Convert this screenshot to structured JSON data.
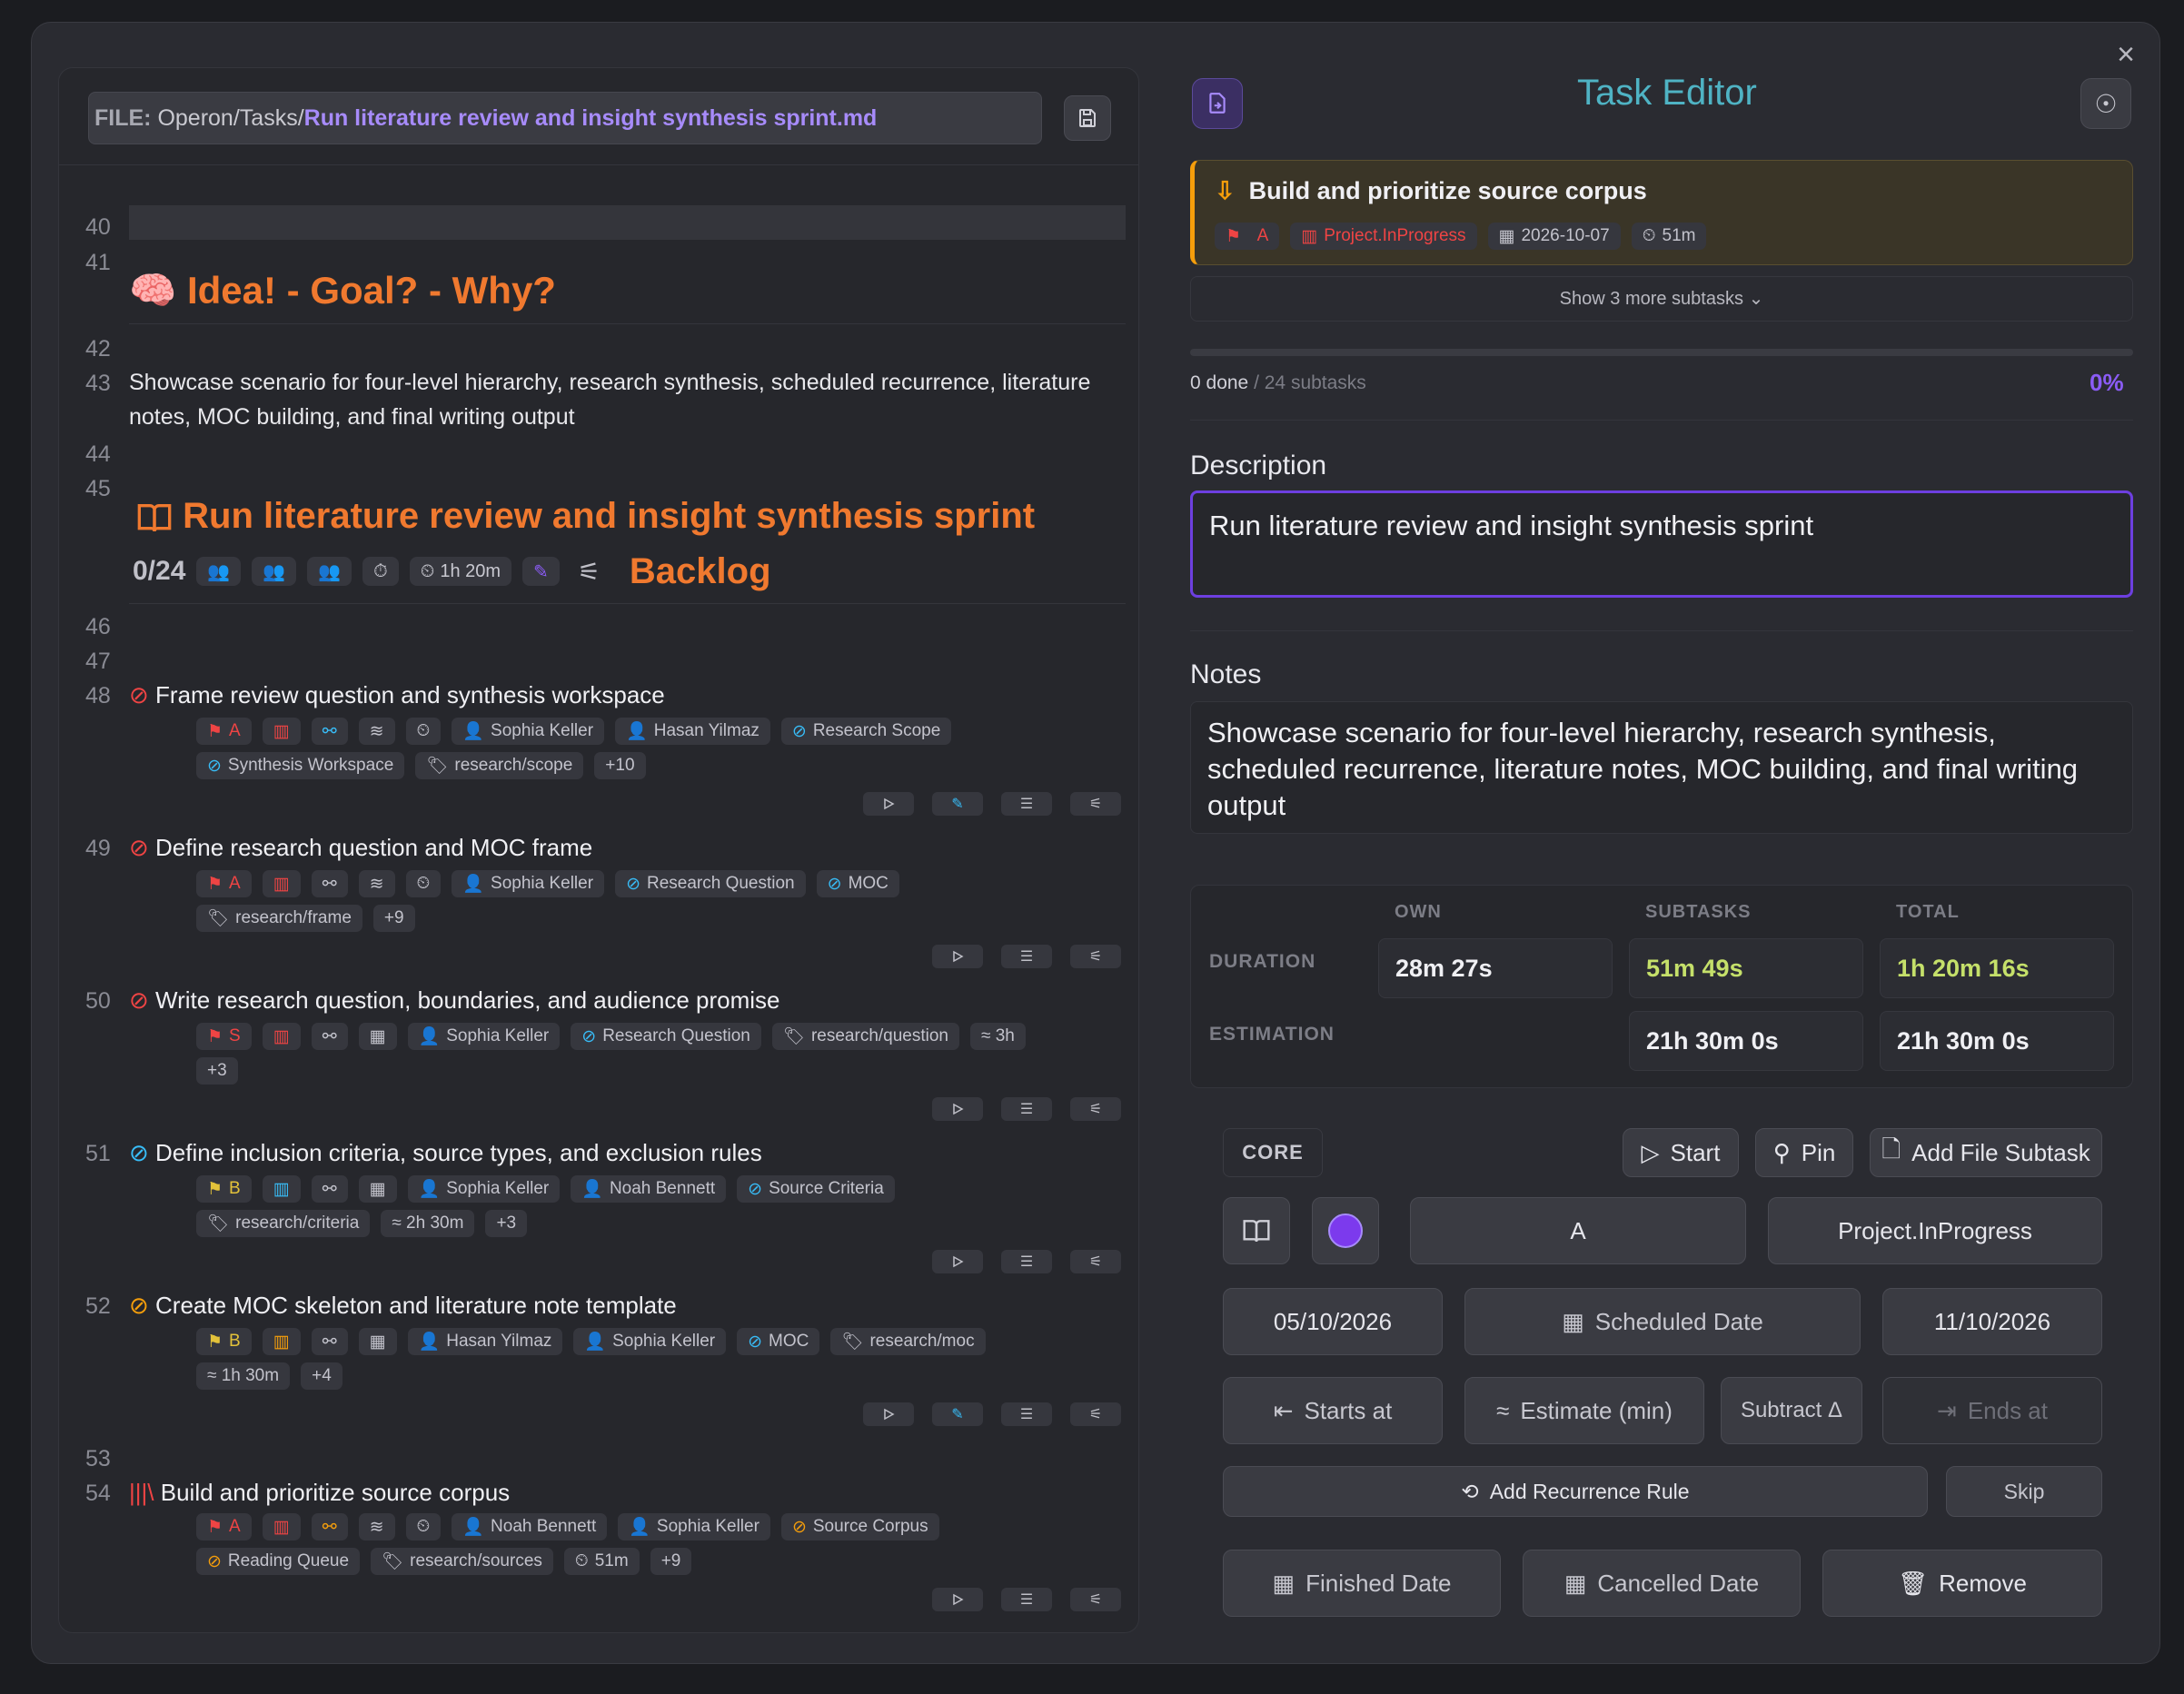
{
  "file_bar": {
    "label": "FILE:",
    "path": "Operon/Tasks/",
    "filename": "Run literature review and insight synthesis sprint.md"
  },
  "editor": {
    "lines": {
      "l40": "40",
      "l41": "41",
      "l42": "42",
      "l43": "43",
      "l44": "44",
      "l45": "45",
      "l46": "46",
      "l47": "47",
      "l48": "48",
      "l49": "49",
      "l50": "50",
      "l51": "51",
      "l52": "52",
      "l53": "53",
      "l54": "54"
    },
    "heading1": "Idea! - Goal? - Why?",
    "paragraph": "Showcase scenario for four-level hierarchy, research synthesis, scheduled recurrence, literature notes, MOC building, and final writing output",
    "task_heading": "Run literature review and insight synthesis sprint",
    "progress": "0/24",
    "duration_tag": "1h 20m",
    "status_heading": "Backlog",
    "tasks": [
      {
        "title": "Frame review question and synthesis workspace",
        "priority": "A",
        "chips": [
          "Sophia Keller",
          "Hasan Yilmaz",
          "Research Scope",
          "Synthesis Workspace",
          "research/scope",
          "+10"
        ]
      },
      {
        "title": "Define research question and MOC frame",
        "priority": "A",
        "chips": [
          "Sophia Keller",
          "Research Question",
          "MOC",
          "research/frame",
          "+9"
        ]
      },
      {
        "title": "Write research question, boundaries, and audience promise",
        "priority": "S",
        "chips": [
          "Sophia Keller",
          "Research Question",
          "research/question",
          "≈ 3h",
          "+3"
        ]
      },
      {
        "title": "Define inclusion criteria, source types, and exclusion rules",
        "priority": "B",
        "chips": [
          "Sophia Keller",
          "Noah Bennett",
          "Source Criteria",
          "research/criteria",
          "≈ 2h 30m",
          "+3"
        ]
      },
      {
        "title": "Create MOC skeleton and literature note template",
        "priority": "B",
        "chips": [
          "Hasan Yilmaz",
          "Sophia Keller",
          "MOC",
          "research/moc",
          "≈ 1h 30m",
          "+4"
        ]
      },
      {
        "title": "Build and prioritize source corpus",
        "priority": "A",
        "chips": [
          "Noah Bennett",
          "Sophia Keller",
          "Source Corpus",
          "Reading Queue",
          "research/sources",
          "51m",
          "+9"
        ]
      }
    ]
  },
  "panel": {
    "title": "Task Editor",
    "parent": {
      "title": "Build and prioritize source corpus",
      "priority": "A",
      "status": "Project.InProgress",
      "date": "2026-10-07",
      "duration": "51m"
    },
    "show_more": "Show 3 more subtasks",
    "progress_done": "0 done",
    "progress_total": "/ 24 subtasks",
    "progress_pct": "0%",
    "progress_value": 0,
    "description_label": "Description",
    "description": "Run literature review and insight synthesis sprint",
    "notes_label": "Notes",
    "notes": "Showcase scenario for four-level hierarchy, research synthesis, scheduled recurrence, literature notes, MOC building, and final writing output",
    "stats": {
      "col_own": "OWN",
      "col_subtasks": "SUBTASKS",
      "col_total": "TOTAL",
      "row_duration": "DURATION",
      "row_estimation": "ESTIMATION",
      "dur_own": "28m 27s",
      "dur_sub": "51m 49s",
      "dur_total": "1h 20m 16s",
      "est_sub": "21h 30m 0s",
      "est_total": "21h 30m 0s"
    },
    "core": {
      "label": "CORE",
      "start": "Start",
      "pin": "Pin",
      "add_file_subtask": "Add File Subtask",
      "priority": "A",
      "status": "Project.InProgress",
      "start_date": "05/10/2026",
      "scheduled": "Scheduled Date",
      "due_date": "11/10/2026",
      "starts_at": "Starts at",
      "estimate": "Estimate (min)",
      "subtract": "Subtract Δ",
      "ends_at": "Ends at",
      "recurrence": "Add Recurrence Rule",
      "skip": "Skip",
      "finished": "Finished Date",
      "cancelled": "Cancelled Date",
      "remove": "Remove"
    }
  },
  "colors": {
    "accent": "#8b5cf6",
    "heading": "#f0792f",
    "title": "#4fb3c4",
    "status_red": "#ef4444",
    "priority_yellow": "#e3c23a"
  }
}
